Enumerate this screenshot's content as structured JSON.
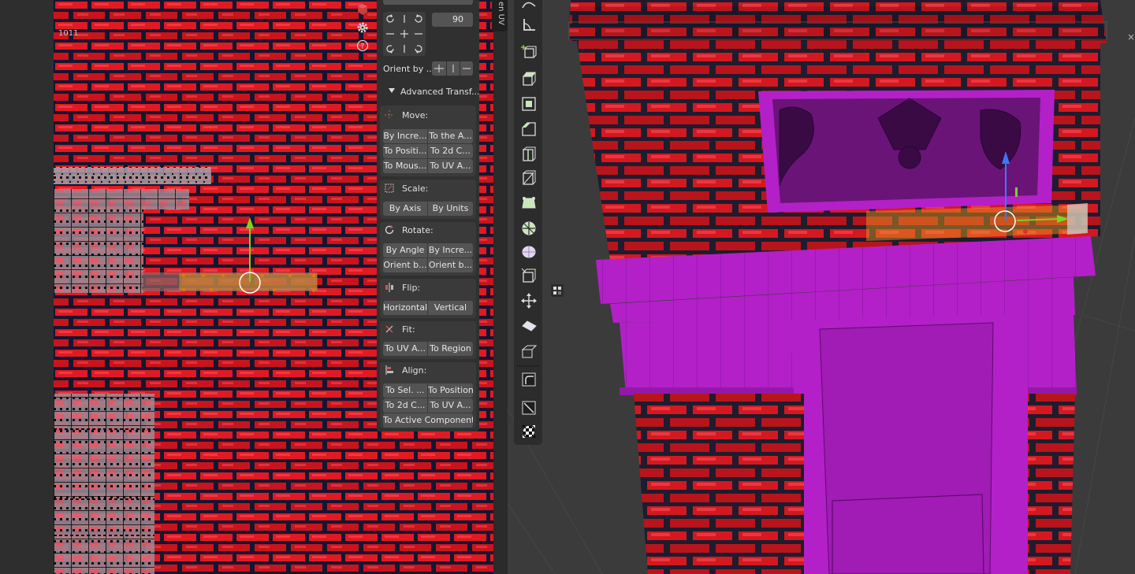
{
  "uv_editor": {
    "tile_label": "1011",
    "header_icons": [
      "cube-icon",
      "gear-icon",
      "help-icon"
    ]
  },
  "side_panel": {
    "tab_label": "en UV",
    "angle_value": "90",
    "orient_label": "Orient by ...",
    "advanced_label": "Advanced Transf...",
    "move": {
      "label": "Move:",
      "buttons": [
        "By Incre...",
        "To the A...",
        "To Positi...",
        "To 2d C...",
        "To Mous...",
        "To UV A..."
      ]
    },
    "scale": {
      "label": "Scale:",
      "buttons": [
        "By Axis",
        "By Units"
      ]
    },
    "rotate": {
      "label": "Rotate:",
      "buttons": [
        "By Angle",
        "By Incre...",
        "Orient b...",
        "Orient b..."
      ]
    },
    "flip": {
      "label": "Flip:",
      "buttons": [
        "Horizontal",
        "Vertical"
      ]
    },
    "fit": {
      "label": "Fit:",
      "buttons": [
        "To UV A...",
        "To Region"
      ]
    },
    "align": {
      "label": "Align:",
      "buttons": [
        "To Sel. ...",
        "To Position",
        "To 2d C...",
        "To UV A...",
        "To Active Component"
      ]
    }
  },
  "viewport": {
    "tools": [
      "curve-icon",
      "measure-icon",
      "add-cube-icon",
      "extrude-icon",
      "inset-icon",
      "bevel-icon",
      "loop-cut-icon",
      "knife-icon",
      "poly-build-icon",
      "spin-icon",
      "smooth-icon",
      "edge-slide-icon",
      "shrink-fatten-icon",
      "shear-icon",
      "rip-icon",
      "uv-edge-icon",
      "uv-square-icon",
      "checker-icon"
    ],
    "edge_glyph": "×"
  },
  "colors": {
    "brick": "#e01a22",
    "mortar": "#181830",
    "magenta": "#b320c8",
    "gizmo_green": "#7ed321",
    "gizmo_blue": "#3a78ff",
    "selection_orange": "#e8a020",
    "panel_bg": "#303030",
    "button_bg": "#545454"
  }
}
